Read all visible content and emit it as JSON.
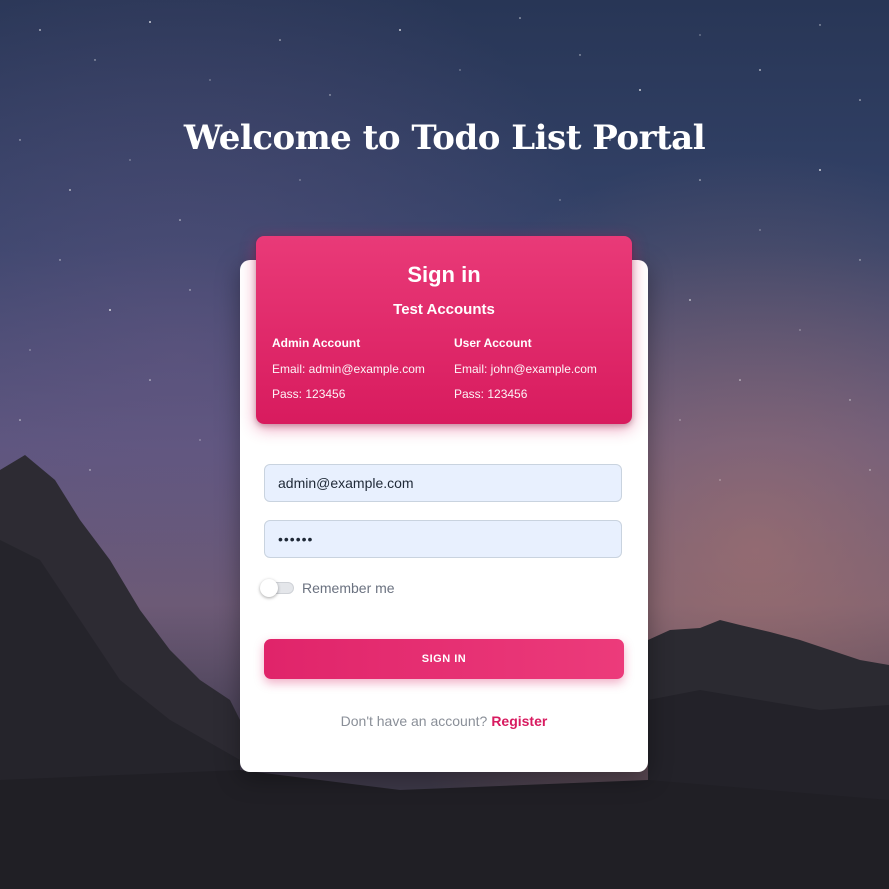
{
  "page": {
    "title": "Welcome to Todo List Portal"
  },
  "card_header": {
    "title": "Sign in",
    "subtitle": "Test Accounts",
    "accounts": [
      {
        "title": "Admin Account",
        "email_line": "Email: admin@example.com",
        "pass_line": "Pass: 123456"
      },
      {
        "title": "User Account",
        "email_line": "Email: john@example.com",
        "pass_line": "Pass: 123456"
      }
    ]
  },
  "form": {
    "email_value": "admin@example.com",
    "password_mask": "••••••",
    "remember_label": "Remember me",
    "remember_checked": false,
    "submit_label": "SIGN IN"
  },
  "footer": {
    "prompt": "Don't have an account?",
    "register_label": "Register"
  },
  "colors": {
    "accent": "#d81b60",
    "input_bg": "#e8f0fe"
  }
}
